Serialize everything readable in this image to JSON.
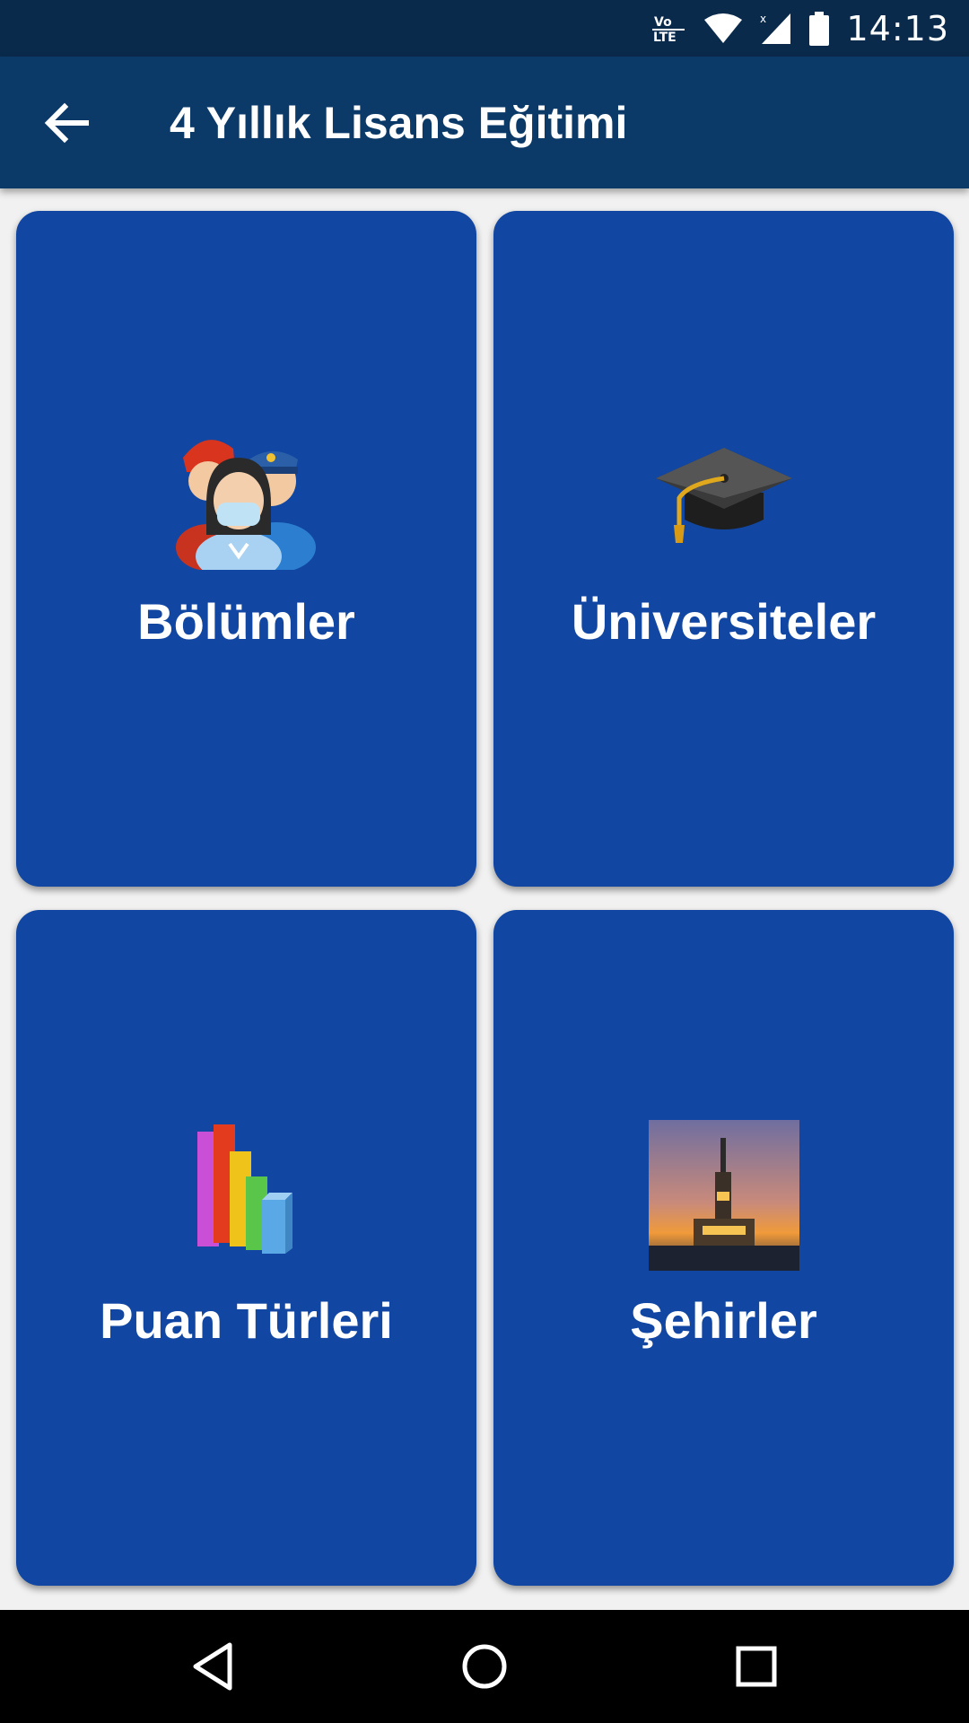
{
  "status_bar": {
    "time": "14:13",
    "icons": [
      "volte-icon",
      "wifi-icon",
      "cell-signal-icon",
      "battery-icon"
    ]
  },
  "app_bar": {
    "title": "4 Yıllık Lisans Eğitimi",
    "back_icon": "arrow-back-icon",
    "background": "#0c3a68"
  },
  "cards": [
    {
      "label": "Bölümler",
      "icon": "professions-people-icon"
    },
    {
      "label": "Üniversiteler",
      "icon": "graduation-cap-icon"
    },
    {
      "label": "Puan Türleri",
      "icon": "bar-chart-icon"
    },
    {
      "label": "Şehirler",
      "icon": "maiden-tower-photo-icon"
    }
  ],
  "colors": {
    "card": "#1147a3",
    "background": "#f1f1f1",
    "status_bar": "#0a2a4c"
  },
  "nav_bar": {
    "icons": [
      "back-triangle-icon",
      "home-circle-icon",
      "recents-square-icon"
    ]
  }
}
